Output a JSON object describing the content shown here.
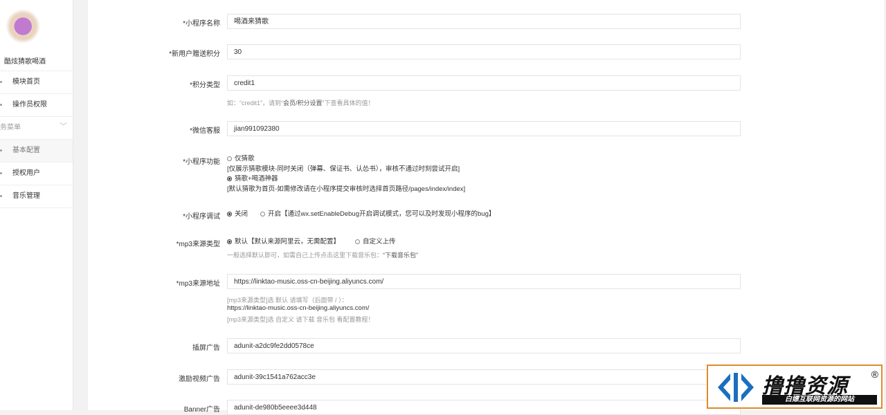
{
  "sidebar": {
    "app_name": "酷炫猜歌喝酒",
    "items": [
      {
        "label": "模块首页"
      },
      {
        "label": "操作员权限"
      }
    ],
    "group": {
      "label": "务菜单"
    },
    "sub_items": [
      {
        "label": "基本配置"
      },
      {
        "label": "授权用户"
      },
      {
        "label": "音乐管理"
      }
    ]
  },
  "form": {
    "name": {
      "label": "*小程序名称",
      "value": "喝酒来猜歌"
    },
    "bonus": {
      "label": "*新用户赠送积分",
      "value": "30"
    },
    "credit_type": {
      "label": "*积分类型",
      "value": "credit1",
      "help_pre": "如：“credit1”，请到“",
      "help_link": "会员/积分设置",
      "help_post": "”下查看具体的值！"
    },
    "wechat": {
      "label": "*微信客服",
      "value": "jian991092380"
    },
    "function": {
      "label": "*小程序功能",
      "option1": "仅猜歌",
      "note1": "[仅展示猜歌模块-同时关闭（弹幕、保证书、认怂书），审核不通过时刻尝试开启]",
      "option2": "猜歌+喝酒神器",
      "note2": "[默认猜歌为首页-如需修改请在小程序提交审核时选择首页路径/pages/index/index]"
    },
    "debug": {
      "label": "*小程序调试",
      "off": "关闭",
      "on": "开启【通过wx.setEnableDebug开启调试模式，您可以及时发现小程序的bug】"
    },
    "mp3_type": {
      "label": "*mp3来源类型",
      "default": "默认【默认来源阿里云，无需配置】",
      "custom": "自定义上传",
      "help_pre": "一般选择默认即可，如需自己上传点击这里下载音乐包：",
      "help_link": "“下载音乐包”"
    },
    "mp3_url": {
      "label": "*mp3来源地址",
      "value": "https://linktao-music.oss-cn-beijing.aliyuncs.com/",
      "help1": "[mp3来源类型]选 默认 请填写（后面带 / ）：",
      "help2": "https://linktao-music.oss-cn-beijing.aliyuncs.com/",
      "help3": "[mp3来源类型]选 自定义 请下载 音乐包 看配置教程！"
    },
    "interstitial": {
      "label": "插屏广告",
      "value": "adunit-a2dc9fe2dd0578ce"
    },
    "rewarded": {
      "label": "激励视频广告",
      "value": "adunit-39c1541a762acc3e"
    },
    "banner": {
      "label": "Banner广告",
      "value": "adunit-de980b5eeee3d448"
    }
  },
  "watermark": {
    "title": "撸撸资源",
    "reg": "®",
    "subtitle": "白嫖互联网资源的网站"
  }
}
